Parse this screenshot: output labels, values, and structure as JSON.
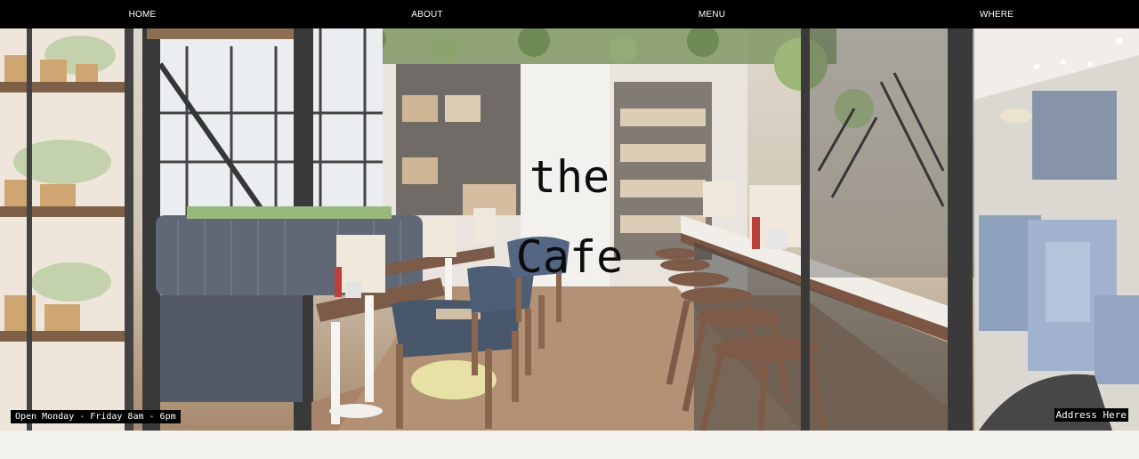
{
  "nav": {
    "items": [
      {
        "label": "HOME"
      },
      {
        "label": "ABOUT"
      },
      {
        "label": "MENU"
      },
      {
        "label": "WHERE"
      }
    ]
  },
  "hero": {
    "title_line1": "the",
    "title_line2": "Cafe",
    "hours": "Open Monday - Friday 8am - 6pm",
    "address": "Address Here"
  },
  "colors": {
    "nav_bg": "#000000",
    "nav_text": "#ffffff",
    "page_bg": "#f4f2ee"
  }
}
